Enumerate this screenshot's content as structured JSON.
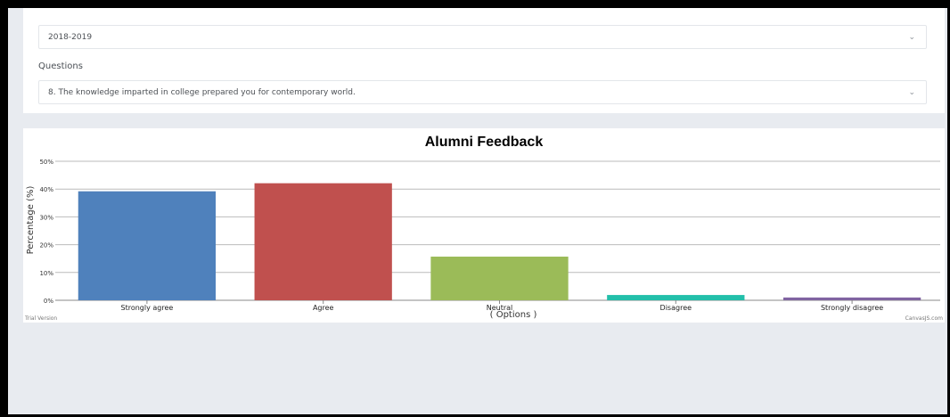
{
  "filters": {
    "year": {
      "value": "2018-2019"
    },
    "questions_label": "Questions",
    "question": {
      "value": "8. The knowledge imparted in college prepared you for contemporary world."
    }
  },
  "chart_data": {
    "type": "bar",
    "title": "Alumni Feedback",
    "xlabel": "( Options )",
    "ylabel": "Percentage (%)",
    "categories": [
      "Strongly agree",
      "Agree",
      "Neutral",
      "Disagree",
      "Strongly disagree"
    ],
    "values": [
      39.2,
      42.1,
      15.7,
      1.9,
      1.0
    ],
    "colors": [
      "#4f81bc",
      "#c0504e",
      "#9bbb58",
      "#23bfaa",
      "#8064a1"
    ],
    "yticks": [
      "0%",
      "10%",
      "20%",
      "30%",
      "40%",
      "50%"
    ],
    "ylim": [
      0,
      50
    ],
    "grid": true,
    "watermark_left": "Trial Version",
    "watermark_right": "CanvasJS.com"
  }
}
